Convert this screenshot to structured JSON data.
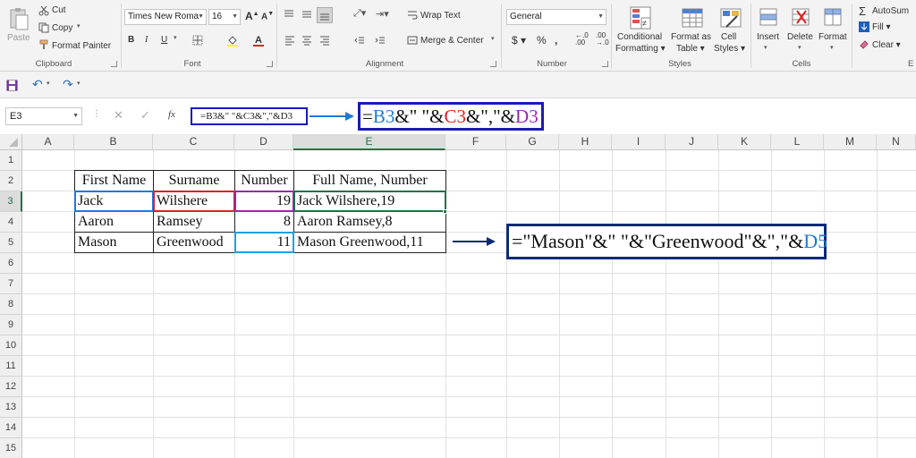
{
  "ribbon": {
    "clipboard": {
      "paste": "Paste",
      "cut": "Cut",
      "copy": "Copy",
      "format_painter": "Format Painter",
      "label": "Clipboard"
    },
    "font": {
      "family": "Times New Roma",
      "size": "16",
      "label": "Font"
    },
    "alignment": {
      "wrap_text": "Wrap Text",
      "merge_center": "Merge & Center",
      "label": "Alignment"
    },
    "number": {
      "format": "General",
      "label": "Number"
    },
    "styles": {
      "conditional": "Conditional",
      "formatting": "Formatting",
      "format_as": "Format as",
      "table": "Table",
      "cell": "Cell",
      "styles_word": "Styles",
      "label": "Styles"
    },
    "cells": {
      "insert": "Insert",
      "delete": "Delete",
      "format": "Format",
      "label": "Cells"
    },
    "editing": {
      "autosum": "AutoSum",
      "fill": "Fill",
      "clear": "Clear"
    }
  },
  "formula_bar": {
    "name_box": "E3",
    "fx": "fx",
    "formula": "=B3&\" \"&C3&\",\"&D3"
  },
  "callouts": {
    "top": {
      "eq": "=",
      "b3": "B3",
      "p1": "&\" \"&",
      "c3": "C3",
      "p2": "&\",\"&",
      "d3": "D3"
    },
    "row5": {
      "text": "=\"Mason\"&\" \"&\"Greenwood\"&\",\"&",
      "d5": "D5"
    }
  },
  "grid": {
    "columns": [
      "A",
      "B",
      "C",
      "D",
      "E",
      "F",
      "G",
      "H",
      "I",
      "J",
      "K",
      "L",
      "M",
      "N"
    ],
    "rows": [
      "1",
      "2",
      "3",
      "4",
      "5",
      "6",
      "7",
      "8",
      "9",
      "10",
      "11",
      "12",
      "13",
      "14",
      "15"
    ],
    "headers": [
      "First Name",
      "Surname",
      "Number",
      "Full Name, Number"
    ],
    "data": [
      [
        "Jack",
        "Wilshere",
        "19",
        "Jack Wilshere,19"
      ],
      [
        "Aaron",
        "Ramsey",
        "8",
        "Aaron Ramsey,8"
      ],
      [
        "Mason",
        "Greenwood",
        "11",
        "Mason Greenwood,11"
      ]
    ]
  },
  "colors": {
    "excel_green": "#217346",
    "callout_blue": "#1a1ab8",
    "ref_blue": "#1e7ad6",
    "ref_red": "#e02020",
    "ref_purple": "#9b27b0"
  }
}
